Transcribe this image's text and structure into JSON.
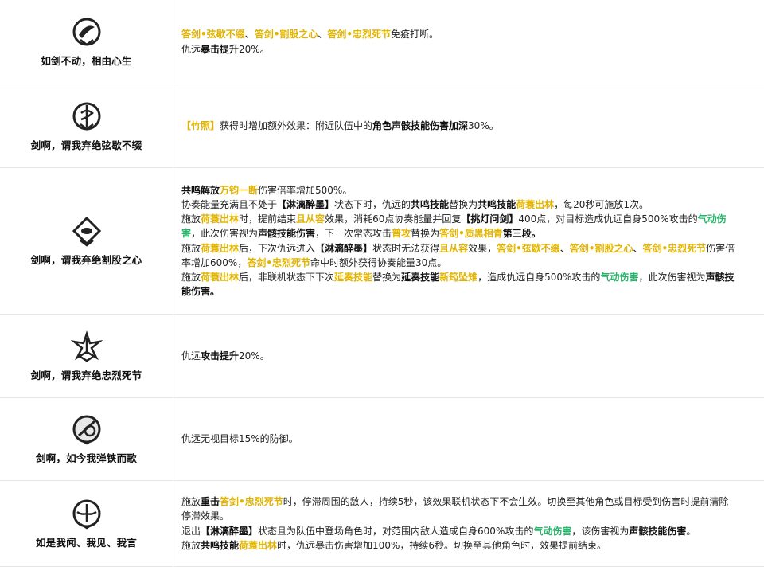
{
  "rows": [
    {
      "icon": "sword-swirl-icon",
      "name": "如剑不动，相由心生",
      "lines": [
        [
          {
            "t": "答剑•弦歇不缀",
            "c": "y"
          },
          {
            "t": "、",
            "c": "n"
          },
          {
            "t": "答剑•割股之心",
            "c": "y"
          },
          {
            "t": "、",
            "c": "n"
          },
          {
            "t": "答剑•忠烈死节",
            "c": "y"
          },
          {
            "t": "免疫打断。",
            "c": "n"
          }
        ],
        [
          {
            "t": "仇远",
            "c": "n"
          },
          {
            "t": "暴击提升",
            "c": "b"
          },
          {
            "t": "20%。",
            "c": "n"
          }
        ]
      ]
    },
    {
      "icon": "sword-spiral-icon",
      "name": "剑啊，谓我弃绝弦歇不辍",
      "lines": [
        [
          {
            "t": "【竹照】",
            "c": "y"
          },
          {
            "t": "获得时增加额外效果：附近队伍中的",
            "c": "n"
          },
          {
            "t": "角色声骸技能伤害加深",
            "c": "b"
          },
          {
            "t": "30%。",
            "c": "n"
          }
        ]
      ]
    },
    {
      "icon": "sword-eye-icon",
      "name": "剑啊，谓我弃绝割股之心",
      "lines": [
        [
          {
            "t": "共鸣解放",
            "c": "b"
          },
          {
            "t": "万钧一断",
            "c": "y"
          },
          {
            "t": "伤害倍率增加500%。",
            "c": "n"
          }
        ],
        [
          {
            "t": "协奏能量充满且不处于",
            "c": "n"
          },
          {
            "t": "【淋漓醉墨】",
            "c": "b"
          },
          {
            "t": "状态下时，仇远的",
            "c": "n"
          },
          {
            "t": "共鸣技能",
            "c": "b"
          },
          {
            "t": "替换为",
            "c": "n"
          },
          {
            "t": "共鸣技能",
            "c": "b"
          },
          {
            "t": "荷蓑出林",
            "c": "y"
          },
          {
            "t": "，每20秒可施放1次。",
            "c": "n"
          }
        ],
        [
          {
            "t": "施放",
            "c": "n"
          },
          {
            "t": "荷蓑出林",
            "c": "y"
          },
          {
            "t": "时，提前结束",
            "c": "n"
          },
          {
            "t": "且从容",
            "c": "y"
          },
          {
            "t": "效果，消耗60点协奏能量并回复",
            "c": "n"
          },
          {
            "t": "【挑灯问剑】",
            "c": "b"
          },
          {
            "t": "400点，对目标造成仇远自身500%攻击的",
            "c": "n"
          },
          {
            "t": "气动伤",
            "c": "g"
          }
        ],
        [
          {
            "t": "害",
            "c": "g"
          },
          {
            "t": "，此次伤害视为",
            "c": "n"
          },
          {
            "t": "声骸技能伤害",
            "c": "b"
          },
          {
            "t": "，下一次常态攻击",
            "c": "n"
          },
          {
            "t": "普攻",
            "c": "y"
          },
          {
            "t": "替换为",
            "c": "n"
          },
          {
            "t": "答剑•质黑相青",
            "c": "y"
          },
          {
            "t": "第三段。",
            "c": "b"
          }
        ],
        [
          {
            "t": "施放",
            "c": "n"
          },
          {
            "t": "荷蓑出林",
            "c": "y"
          },
          {
            "t": "后，下次仇远进入",
            "c": "n"
          },
          {
            "t": "【淋漓醉墨】",
            "c": "b"
          },
          {
            "t": "状态时无法获得",
            "c": "n"
          },
          {
            "t": "且从容",
            "c": "y"
          },
          {
            "t": "效果，",
            "c": "n"
          },
          {
            "t": "答剑•弦歇不缀",
            "c": "y"
          },
          {
            "t": "、",
            "c": "n"
          },
          {
            "t": "答剑•割股之心",
            "c": "y"
          },
          {
            "t": "、",
            "c": "n"
          },
          {
            "t": "答剑•忠烈死节",
            "c": "y"
          },
          {
            "t": "伤害倍",
            "c": "n"
          }
        ],
        [
          {
            "t": "率增加600%，",
            "c": "n"
          },
          {
            "t": "答剑•忠烈死节",
            "c": "y"
          },
          {
            "t": "命中时额外获得协奏能量30点。",
            "c": "n"
          }
        ],
        [
          {
            "t": "施放",
            "c": "n"
          },
          {
            "t": "荷蓑出林",
            "c": "y"
          },
          {
            "t": "后，非联机状态下下次",
            "c": "n"
          },
          {
            "t": "延奏技能",
            "c": "y"
          },
          {
            "t": "替换为",
            "c": "n"
          },
          {
            "t": "延奏技能",
            "c": "b"
          },
          {
            "t": "新筠坠雉",
            "c": "y"
          },
          {
            "t": "，造成仇远自身500%攻击的",
            "c": "n"
          },
          {
            "t": "气动伤害",
            "c": "g"
          },
          {
            "t": "，此次伤害视为",
            "c": "n"
          },
          {
            "t": "声骸技",
            "c": "b"
          }
        ],
        [
          {
            "t": "能伤害。",
            "c": "b"
          }
        ]
      ]
    },
    {
      "icon": "sword-burst-icon",
      "name": "剑啊，谓我弃绝忠烈死节",
      "lines": [
        [
          {
            "t": "仇远",
            "c": "n"
          },
          {
            "t": "攻击提升",
            "c": "b"
          },
          {
            "t": "20%。",
            "c": "n"
          }
        ]
      ]
    },
    {
      "icon": "sword-shield-icon",
      "name": "剑啊，如今我弹铗而歌",
      "lines": [
        [
          {
            "t": "仇远无视目标15%的防御。",
            "c": "n"
          }
        ]
      ]
    },
    {
      "icon": "sword-wings-icon",
      "name": "如是我闻、我见、我言",
      "lines": [
        [
          {
            "t": "施放",
            "c": "n"
          },
          {
            "t": "重击",
            "c": "b"
          },
          {
            "t": "答剑•忠烈死节",
            "c": "y"
          },
          {
            "t": "时，停滞周围的敌人，持续5秒，该效果联机状态下不会生效。切换至其他角色或目标受到伤害时提前清除",
            "c": "n"
          }
        ],
        [
          {
            "t": "停滞效果。",
            "c": "n"
          }
        ],
        [
          {
            "t": "退出",
            "c": "n"
          },
          {
            "t": "【淋漓醉墨】",
            "c": "b"
          },
          {
            "t": "状态且为队伍中登场角色时，对范围内敌人造成自身600%攻击的",
            "c": "n"
          },
          {
            "t": "气动伤害",
            "c": "g"
          },
          {
            "t": "，该伤害视为",
            "c": "n"
          },
          {
            "t": "声骸技能伤害",
            "c": "b"
          },
          {
            "t": "。",
            "c": "n"
          }
        ],
        [
          {
            "t": "施放",
            "c": "n"
          },
          {
            "t": "共鸣技能",
            "c": "b"
          },
          {
            "t": "荷蓑出林",
            "c": "y"
          },
          {
            "t": "时，仇远暴击伤害增加100%，持续6秒。切换至其他角色时，效果提前结束。",
            "c": "n"
          }
        ]
      ]
    }
  ]
}
